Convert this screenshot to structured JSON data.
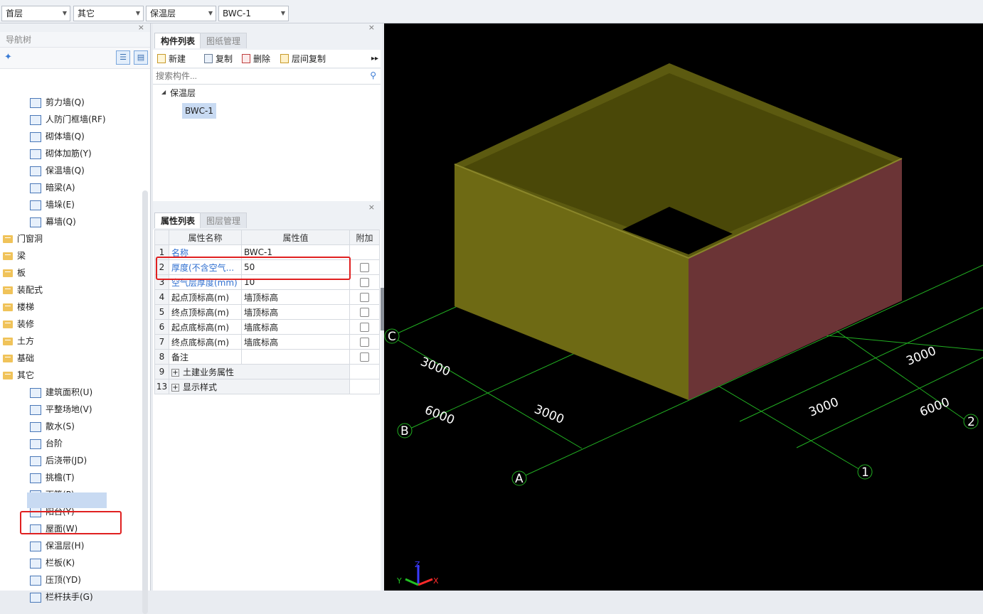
{
  "topbar": {
    "floor": "首层",
    "category": "其它",
    "component_type": "保温层",
    "component": "BWC-1"
  },
  "nav": {
    "title": "导航树",
    "items": [
      {
        "label": "剪力墙(Q)",
        "icon": "shear-wall-icon",
        "level": 2
      },
      {
        "label": "人防门框墙(RF)",
        "icon": "door-frame-wall-icon",
        "level": 2
      },
      {
        "label": "砌体墙(Q)",
        "icon": "masonry-wall-icon",
        "level": 2
      },
      {
        "label": "砌体加筋(Y)",
        "icon": "masonry-rebar-icon",
        "level": 2
      },
      {
        "label": "保温墙(Q)",
        "icon": "insulation-wall-icon",
        "level": 2
      },
      {
        "label": "暗梁(A)",
        "icon": "hidden-beam-icon",
        "level": 2
      },
      {
        "label": "墙垛(E)",
        "icon": "wall-pier-icon",
        "level": 2
      },
      {
        "label": "幕墙(Q)",
        "icon": "curtain-wall-icon",
        "level": 2
      },
      {
        "label": "门窗洞",
        "icon": "folder-icon",
        "level": 1
      },
      {
        "label": "梁",
        "icon": "folder-icon",
        "level": 1
      },
      {
        "label": "板",
        "icon": "folder-icon",
        "level": 1
      },
      {
        "label": "装配式",
        "icon": "folder-icon",
        "level": 1
      },
      {
        "label": "楼梯",
        "icon": "folder-icon",
        "level": 1
      },
      {
        "label": "装修",
        "icon": "folder-icon",
        "level": 1
      },
      {
        "label": "土方",
        "icon": "folder-icon",
        "level": 1
      },
      {
        "label": "基础",
        "icon": "folder-icon",
        "level": 1
      },
      {
        "label": "其它",
        "icon": "folder-open-icon",
        "level": 1
      },
      {
        "label": "建筑面积(U)",
        "icon": "building-area-icon",
        "level": 2
      },
      {
        "label": "平整场地(V)",
        "icon": "site-leveling-icon",
        "level": 2
      },
      {
        "label": "散水(S)",
        "icon": "apron-icon",
        "level": 2
      },
      {
        "label": "台阶",
        "icon": "steps-icon",
        "level": 2
      },
      {
        "label": "后浇带(JD)",
        "icon": "post-cast-strip-icon",
        "level": 2
      },
      {
        "label": "挑檐(T)",
        "icon": "eave-icon",
        "level": 2
      },
      {
        "label": "雨篷(P)",
        "icon": "canopy-icon",
        "level": 2
      },
      {
        "label": "阳台(Y)",
        "icon": "balcony-icon",
        "level": 2
      },
      {
        "label": "屋面(W)",
        "icon": "roof-icon",
        "level": 2
      },
      {
        "label": "保温层(H)",
        "icon": "insulation-layer-icon",
        "level": 2,
        "selected": true
      },
      {
        "label": "栏板(K)",
        "icon": "parapet-icon",
        "level": 2
      },
      {
        "label": "压顶(YD)",
        "icon": "coping-icon",
        "level": 2
      },
      {
        "label": "栏杆扶手(G)",
        "icon": "railing-icon",
        "level": 2
      }
    ]
  },
  "component_panel": {
    "tabs": [
      "构件列表",
      "图纸管理"
    ],
    "toolbar": [
      "新建",
      "复制",
      "删除",
      "层间复制"
    ],
    "search_placeholder": "搜索构件...",
    "group": "保温层",
    "item": "BWC-1"
  },
  "property_panel": {
    "tabs": [
      "属性列表",
      "图层管理"
    ],
    "headers": [
      "属性名称",
      "属性值",
      "附加"
    ],
    "rows": [
      {
        "no": "1",
        "name": "名称",
        "value": "BWC-1",
        "blue": true,
        "checkbox": false
      },
      {
        "no": "2",
        "name": "厚度(不含空气...",
        "value": "50",
        "blue": true,
        "checkbox": true
      },
      {
        "no": "3",
        "name": "空气层厚度(mm)",
        "value": "10",
        "blue": true,
        "checkbox": true
      },
      {
        "no": "4",
        "name": "起点顶标高(m)",
        "value": "墙顶标高",
        "blue": false,
        "checkbox": true
      },
      {
        "no": "5",
        "name": "终点顶标高(m)",
        "value": "墙顶标高",
        "blue": false,
        "checkbox": true
      },
      {
        "no": "6",
        "name": "起点底标高(m)",
        "value": "墙底标高",
        "blue": false,
        "checkbox": true
      },
      {
        "no": "7",
        "name": "终点底标高(m)",
        "value": "墙底标高",
        "blue": false,
        "checkbox": true
      },
      {
        "no": "8",
        "name": "备注",
        "value": "",
        "blue": false,
        "checkbox": true
      }
    ],
    "groups": [
      {
        "no": "9",
        "name": "土建业务属性"
      },
      {
        "no": "13",
        "name": "显示样式"
      }
    ]
  },
  "viewport": {
    "axis_labels": [
      "A",
      "B",
      "C",
      "1",
      "2"
    ],
    "dimensions": [
      "3000",
      "3000",
      "6000",
      "3000",
      "3000",
      "6000"
    ],
    "axes_gizmo": [
      "X",
      "Y",
      "Z"
    ],
    "colors": {
      "background": "#000000",
      "wall": "#6e6a14",
      "wall_side": "#6b3436",
      "grid": "#22b022"
    }
  }
}
